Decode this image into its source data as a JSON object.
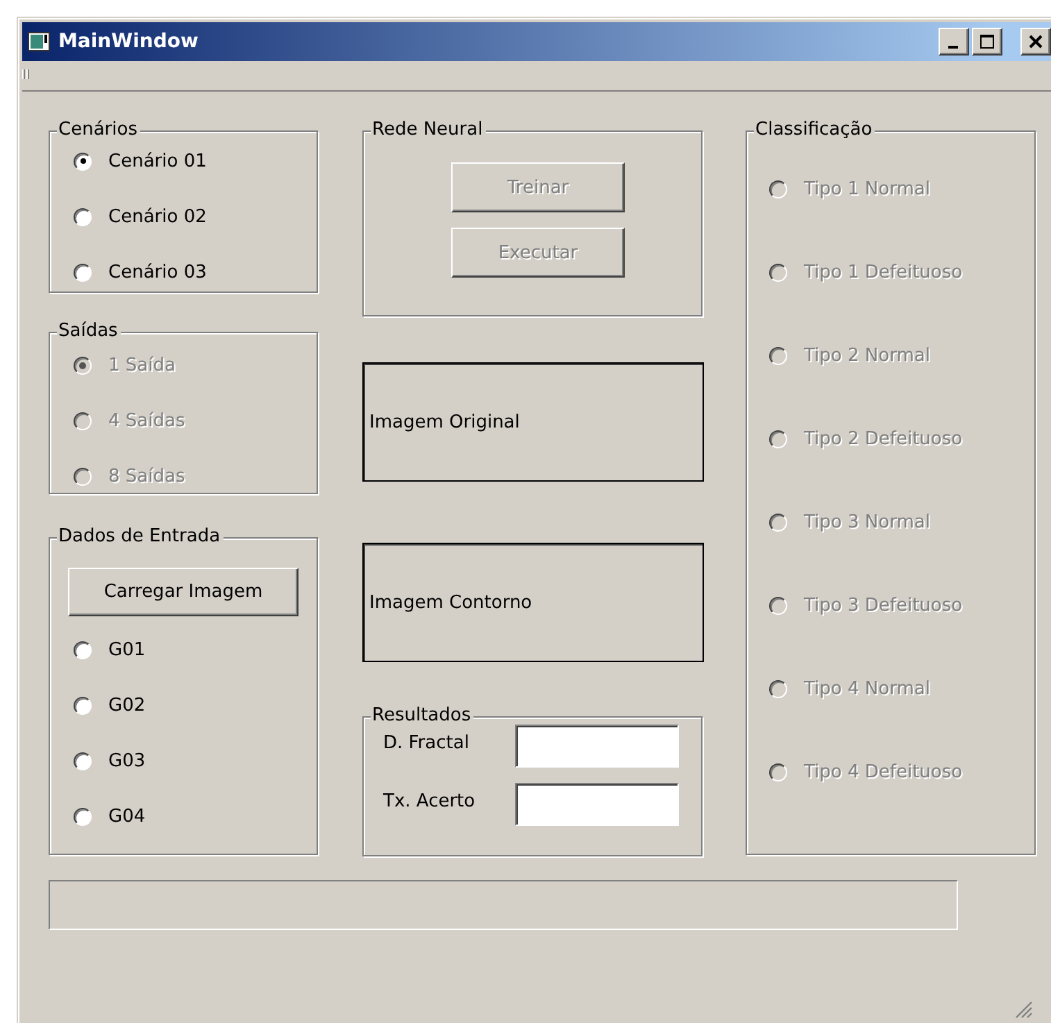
{
  "window": {
    "title": "MainWindow"
  },
  "cenarios": {
    "title": "Cenários",
    "options": [
      {
        "label": "Cenário 01",
        "selected": true,
        "disabled": false
      },
      {
        "label": "Cenário 02",
        "selected": false,
        "disabled": false
      },
      {
        "label": "Cenário 03",
        "selected": false,
        "disabled": false
      }
    ]
  },
  "saidas": {
    "title": "Saídas",
    "options": [
      {
        "label": "1 Saída",
        "selected": true,
        "disabled": true
      },
      {
        "label": "4 Saídas",
        "selected": false,
        "disabled": true
      },
      {
        "label": "8 Saídas",
        "selected": false,
        "disabled": true
      }
    ]
  },
  "dados_entrada": {
    "title": "Dados de Entrada",
    "button": {
      "label": "Carregar Imagem",
      "disabled": false
    },
    "options": [
      {
        "label": "G01",
        "selected": false,
        "disabled": false
      },
      {
        "label": "G02",
        "selected": false,
        "disabled": false
      },
      {
        "label": "G03",
        "selected": false,
        "disabled": false
      },
      {
        "label": "G04",
        "selected": false,
        "disabled": false
      }
    ]
  },
  "rede_neural": {
    "title": "Rede Neural",
    "buttons": [
      {
        "label": "Treinar",
        "disabled": true
      },
      {
        "label": "Executar",
        "disabled": true
      }
    ]
  },
  "image_frames": [
    {
      "label": "Imagem Original"
    },
    {
      "label": "Imagem Contorno"
    }
  ],
  "resultados": {
    "title": "Resultados",
    "fields": [
      {
        "label": "D. Fractal"
      },
      {
        "label": "Tx. Acerto"
      }
    ]
  },
  "classificacao": {
    "title": "Classificação",
    "options": [
      {
        "label": "Tipo 1 Normal",
        "selected": false,
        "disabled": true
      },
      {
        "label": "Tipo 1 Defeituoso",
        "selected": false,
        "disabled": true
      },
      {
        "label": "Tipo 2 Normal",
        "selected": false,
        "disabled": true
      },
      {
        "label": "Tipo 2 Defeituoso",
        "selected": false,
        "disabled": true
      },
      {
        "label": "Tipo 3 Normal",
        "selected": false,
        "disabled": true
      },
      {
        "label": "Tipo 3 Defeituoso",
        "selected": false,
        "disabled": true
      },
      {
        "label": "Tipo 4 Normal",
        "selected": false,
        "disabled": true
      },
      {
        "label": "Tipo 4 Defeituoso",
        "selected": false,
        "disabled": true
      }
    ]
  }
}
